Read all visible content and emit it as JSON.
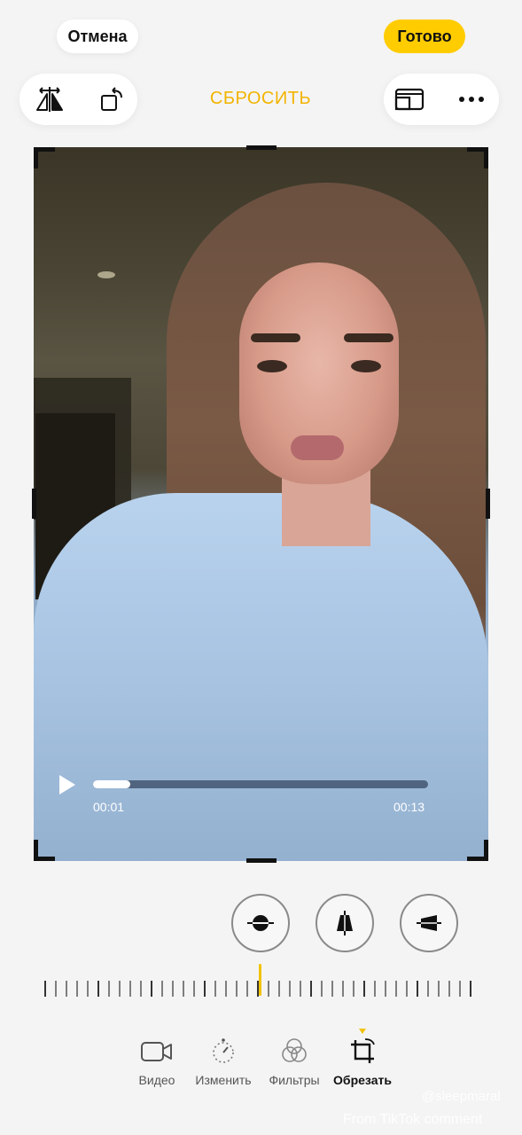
{
  "header": {
    "cancel_label": "Отмена",
    "done_label": "Готово",
    "reset_label": "СБРОСИТЬ"
  },
  "toolbar": {
    "left_icons": [
      "flip-horizontal-icon",
      "rotate-icon"
    ],
    "right_icons": [
      "aspect-ratio-icon",
      "more-icon"
    ]
  },
  "player": {
    "current_time": "00:01",
    "total_time": "00:13",
    "progress": 0.11
  },
  "perspective": {
    "buttons": [
      "straighten-icon",
      "vertical-perspective-icon",
      "horizontal-perspective-icon"
    ]
  },
  "tabs": [
    {
      "label": "Видео",
      "icon": "video-camera-icon"
    },
    {
      "label": "Изменить",
      "icon": "adjust-dial-icon"
    },
    {
      "label": "Фильтры",
      "icon": "filters-icon"
    },
    {
      "label": "Обрезать",
      "icon": "crop-rotate-icon",
      "active": true
    }
  ],
  "watermark": {
    "handle": "@sleepmaral",
    "source": "From TikTok comment"
  },
  "colors": {
    "accent": "#ffcc00",
    "reset_text": "#f2b400",
    "background": "#f4f4f4"
  }
}
